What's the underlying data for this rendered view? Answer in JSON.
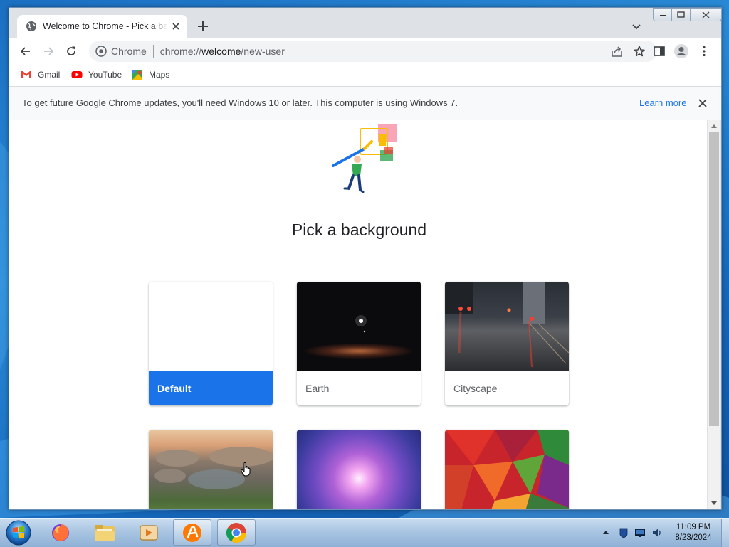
{
  "window": {
    "tab_title": "Welcome to Chrome - Pick a background",
    "new_tab_icon": "plus-icon",
    "tab_search_icon": "chevron-down-icon"
  },
  "toolbar": {
    "omnibox_chip": "Chrome",
    "url_scheme": "chrome://",
    "url_host": "welcome",
    "url_path": "/new-user"
  },
  "bookmarks": [
    {
      "label": "Gmail",
      "icon": "gmail-icon"
    },
    {
      "label": "YouTube",
      "icon": "youtube-icon"
    },
    {
      "label": "Maps",
      "icon": "maps-icon"
    }
  ],
  "infobar": {
    "message": "To get future Google Chrome updates, you'll need Windows 10 or later. This computer is using Windows 7.",
    "link": "Learn more"
  },
  "page": {
    "heading": "Pick a background",
    "tiles": [
      {
        "label": "Default",
        "selected": true
      },
      {
        "label": "Earth",
        "selected": false
      },
      {
        "label": "Cityscape",
        "selected": false
      },
      {
        "label": "",
        "selected": false
      },
      {
        "label": "",
        "selected": false
      },
      {
        "label": "",
        "selected": false
      }
    ]
  },
  "colors": {
    "accent": "#1a73e8",
    "tabstrip": "#dee1e6"
  },
  "taskbar": {
    "apps": [
      "firefox",
      "file-explorer",
      "media-player",
      "avast",
      "chrome"
    ],
    "time": "11:09 PM",
    "date": "8/23/2024"
  }
}
